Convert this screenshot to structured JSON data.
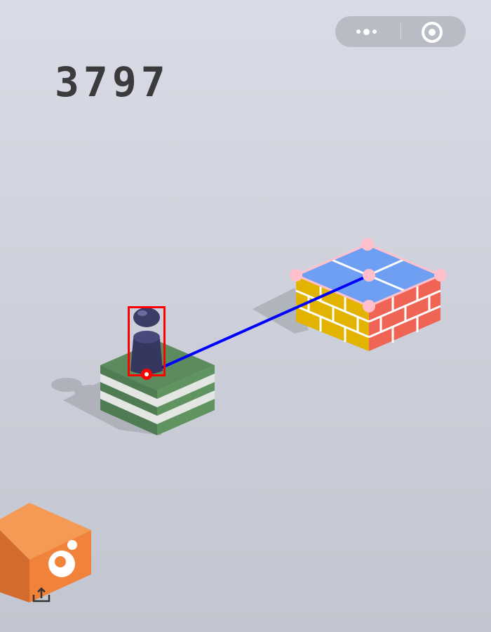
{
  "hud": {
    "score": "3797"
  },
  "capsule": {
    "more_icon": "more-dots-icon",
    "close_icon": "target-circle-icon"
  },
  "colors": {
    "background_top": "#d9dce6",
    "green_block": "#5b8b5e",
    "stripe": "#e4e6e3",
    "brick_yellow": "#e2b300",
    "brick_red": "#ef6455",
    "tile_blue": "#6e9ff2",
    "orange_block": "#f0823a",
    "aim_line": "#0000ff",
    "bbox": "#ff0000",
    "keypoints": "#ffc0cb"
  },
  "icons": [
    "share-icon",
    "logo-icon"
  ]
}
